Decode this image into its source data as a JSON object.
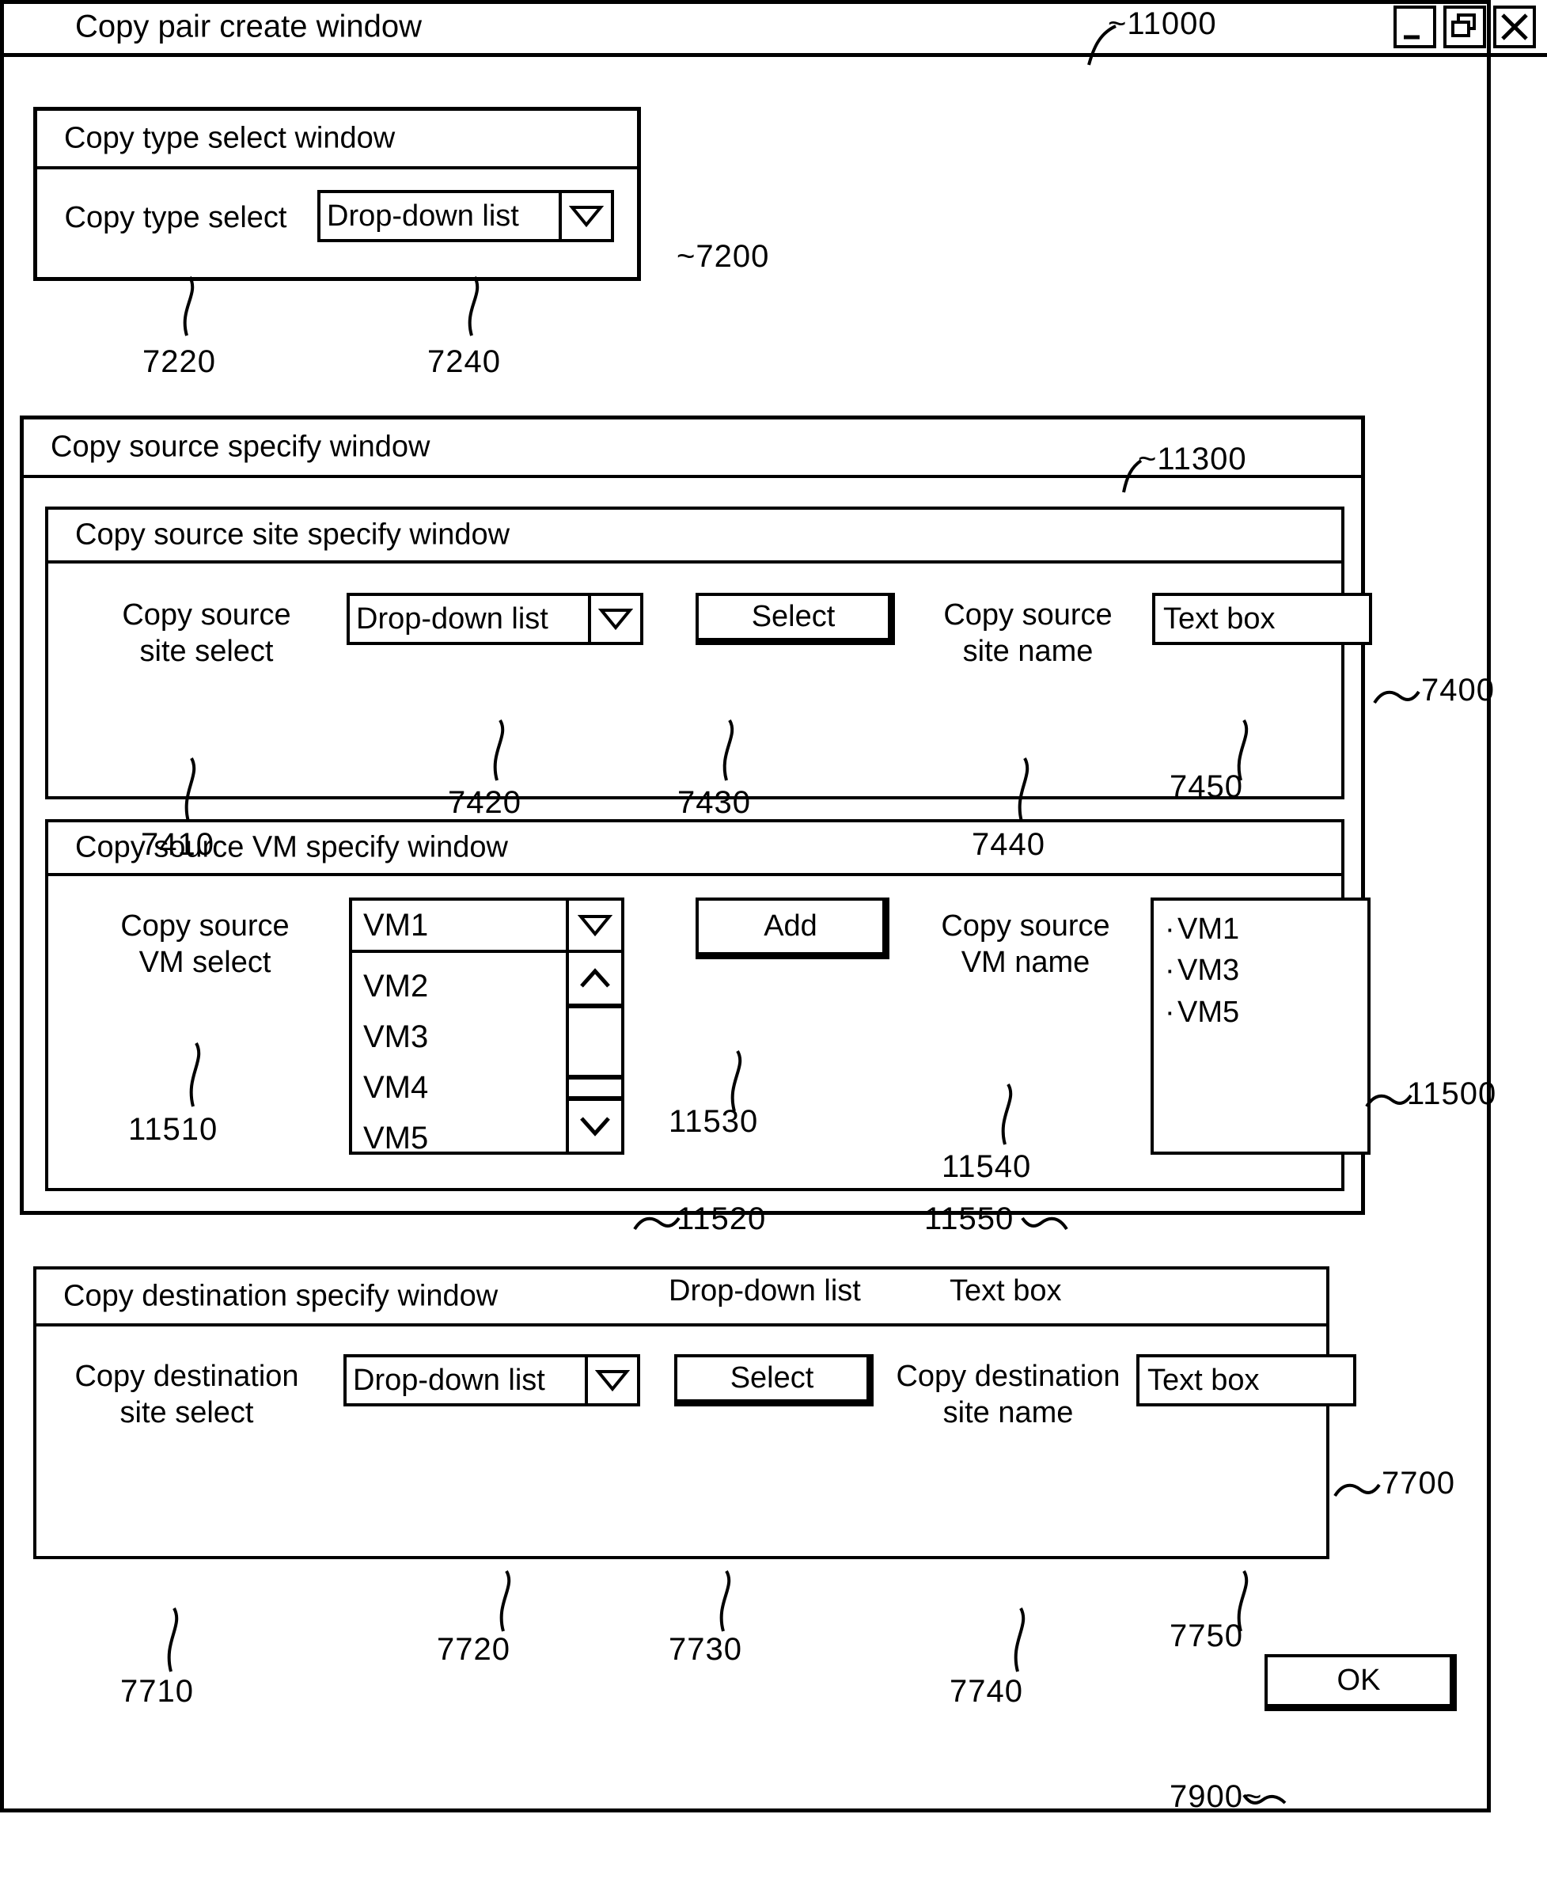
{
  "figure": {
    "main_window_ref": "11000",
    "copy_type_window_ref": "7200",
    "copy_source_window_ref": "11300",
    "copy_source_site_window_ref": "7400",
    "copy_source_vm_window_ref": "11500",
    "copy_destination_window_ref": "7700",
    "ok_button_ref": "7900"
  },
  "main_window": {
    "title": "Copy pair create window",
    "controls": {
      "minimize": "minimize-icon",
      "restore": "restore-icon",
      "close": "close-icon"
    }
  },
  "copy_type_window": {
    "header": "Copy type select window",
    "field_label": "Copy type select",
    "field_label_ref": "7220",
    "dropdown_value": "Drop-down list",
    "dropdown_ref": "7240"
  },
  "copy_source_window": {
    "header": "Copy source specify window"
  },
  "copy_source_site_window": {
    "header": "Copy source site specify window",
    "select_label_line1": "Copy source",
    "select_label_line2": "site select",
    "select_label_ref": "7410",
    "dropdown_value": "Drop-down list",
    "dropdown_ref": "7420",
    "select_button": "Select",
    "select_button_ref": "7430",
    "name_label_line1": "Copy source",
    "name_label_line2": "site name",
    "name_label_ref": "7440",
    "textbox_value": "Text box",
    "textbox_ref": "7450"
  },
  "copy_source_vm_window": {
    "header": "Copy source VM specify window",
    "select_label_line1": "Copy source",
    "select_label_line2": "VM select",
    "select_label_ref": "11510",
    "dropdown_selected": "VM1",
    "dropdown_options": [
      "VM2",
      "VM3",
      "VM4",
      "VM5"
    ],
    "dropdown_ref": "11520",
    "dropdown_caption": "Drop-down list",
    "add_button": "Add",
    "add_button_ref": "11530",
    "name_label_line1": "Copy source",
    "name_label_line2": "VM name",
    "name_label_ref": "11540",
    "name_box_ref": "11550",
    "name_box_caption": "Text box",
    "name_box_items": [
      "VM1",
      "VM3",
      "VM5"
    ]
  },
  "copy_destination_window": {
    "header": "Copy destination specify window",
    "select_label_line1": "Copy destination",
    "select_label_line2": "site select",
    "select_label_ref": "7710",
    "dropdown_value": "Drop-down list",
    "dropdown_ref": "7720",
    "select_button": "Select",
    "select_button_ref": "7730",
    "name_label_line1": "Copy destination",
    "name_label_line2": "site name",
    "name_label_ref": "7740",
    "textbox_value": "Text box",
    "textbox_ref": "7750"
  },
  "footer": {
    "ok_button": "OK"
  }
}
